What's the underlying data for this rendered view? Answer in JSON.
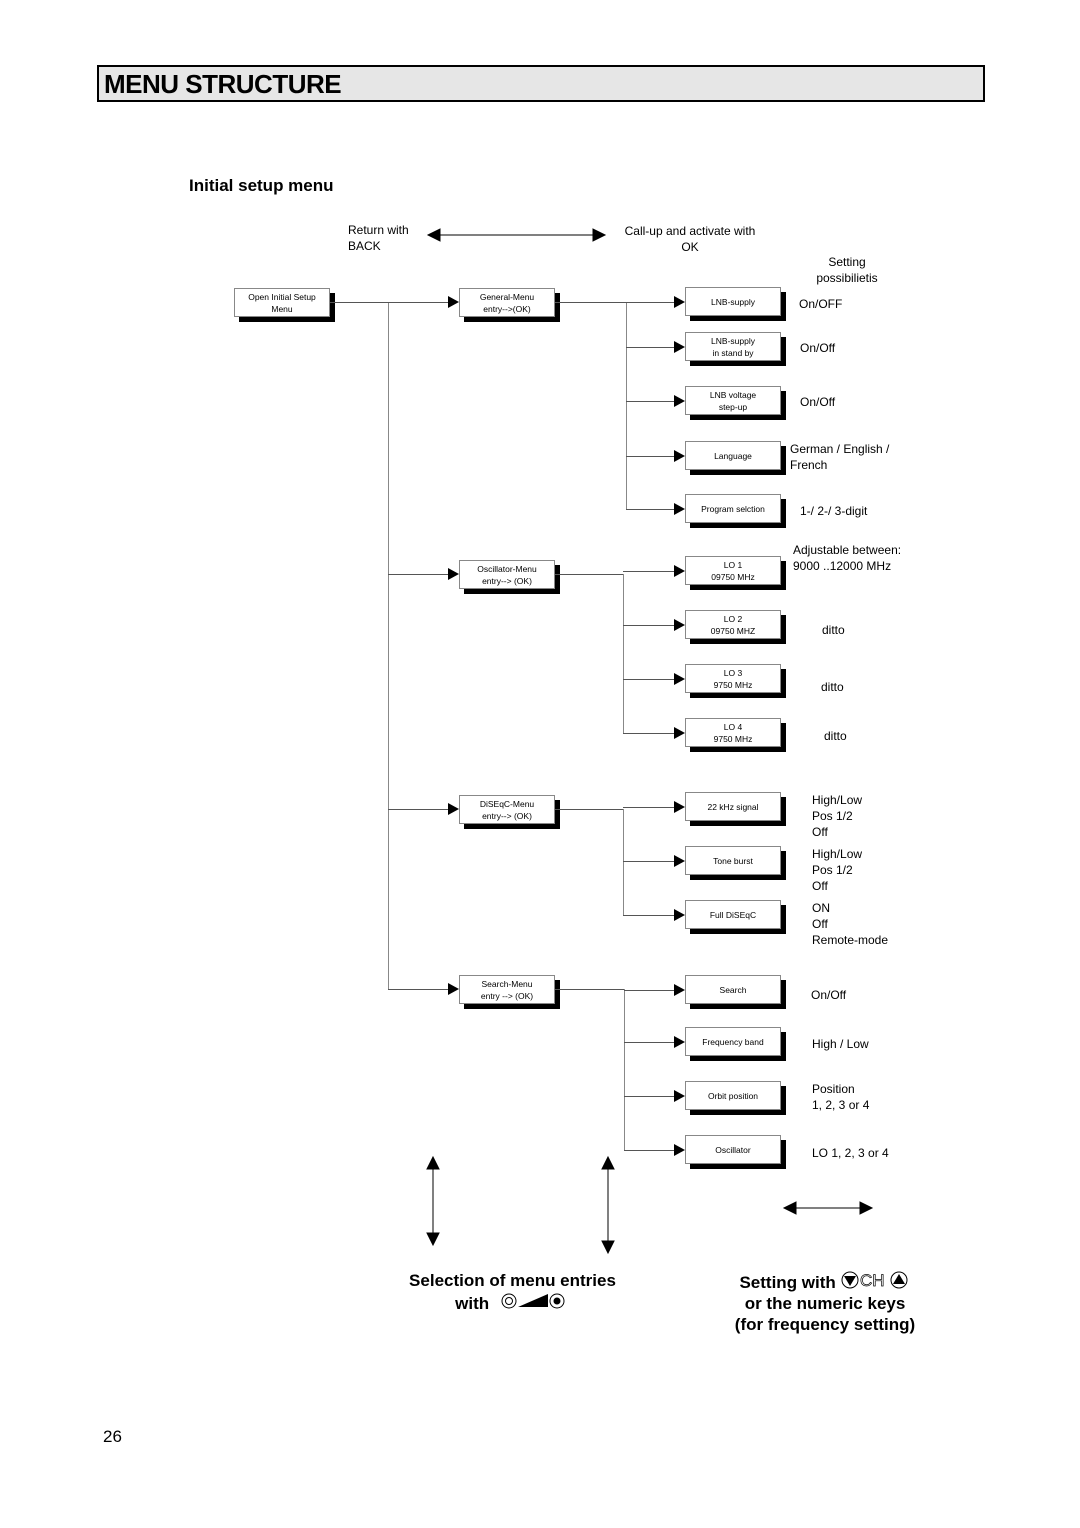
{
  "header": {
    "title": "MENU STRUCTURE"
  },
  "subtitle": "Initial setup menu",
  "legend": {
    "return_label": [
      "Return with",
      "BACK"
    ],
    "activate_label": [
      "Call-up and activate with",
      "OK"
    ],
    "settings_heading": [
      "Setting",
      "possibilietis"
    ]
  },
  "root": {
    "label": [
      "Open Initial Setup",
      "Menu"
    ]
  },
  "menus": [
    {
      "label": [
        "General-Menu",
        "entry-->(OK)"
      ],
      "items": [
        {
          "label": [
            "LNB-supply"
          ],
          "setting": "On/OFF"
        },
        {
          "label": [
            "LNB-supply",
            "in stand by"
          ],
          "setting": "On/Off"
        },
        {
          "label": [
            "LNB voltage",
            "step-up"
          ],
          "setting": "On/Off"
        },
        {
          "label": [
            "Language"
          ],
          "setting": "German / English /\nFrench"
        },
        {
          "label": [
            "Program selction"
          ],
          "setting": "1-/ 2-/ 3-digit"
        }
      ]
    },
    {
      "label": [
        "Oscillator-Menu",
        "entry--> (OK)"
      ],
      "items": [
        {
          "label": [
            "LO 1",
            "09750 MHz"
          ],
          "setting": "Adjustable between:\n9000 ..12000 MHz"
        },
        {
          "label": [
            "LO 2",
            "09750 MHZ"
          ],
          "setting": "ditto"
        },
        {
          "label": [
            "LO 3",
            "9750 MHz"
          ],
          "setting": "ditto"
        },
        {
          "label": [
            "LO 4",
            "9750 MHz"
          ],
          "setting": "ditto"
        }
      ]
    },
    {
      "label": [
        "DiSEqC-Menu",
        "entry--> (OK)"
      ],
      "items": [
        {
          "label": [
            "22 kHz signal"
          ],
          "setting": "High/Low\nPos 1/2\nOff"
        },
        {
          "label": [
            "Tone burst"
          ],
          "setting": "High/Low\nPos 1/2\nOff"
        },
        {
          "label": [
            "Full DiSEqC"
          ],
          "setting": "ON\nOff\nRemote-mode"
        }
      ]
    },
    {
      "label": [
        "Search-Menu",
        "entry --> (OK)"
      ],
      "items": [
        {
          "label": [
            "Search"
          ],
          "setting": "On/Off"
        },
        {
          "label": [
            "Frequency band"
          ],
          "setting": "High / Low"
        },
        {
          "label": [
            "Orbit position"
          ],
          "setting": "Position\n1, 2, 3 or 4"
        },
        {
          "label": [
            "Oscillator"
          ],
          "setting": "LO 1, 2, 3 or 4"
        }
      ]
    }
  ],
  "footer": {
    "selection": [
      "Selection of menu entries",
      "with"
    ],
    "setting": [
      "Setting with",
      "or the numeric keys",
      "(for frequency setting)"
    ],
    "ch_label": "CH"
  },
  "page_number": "26"
}
